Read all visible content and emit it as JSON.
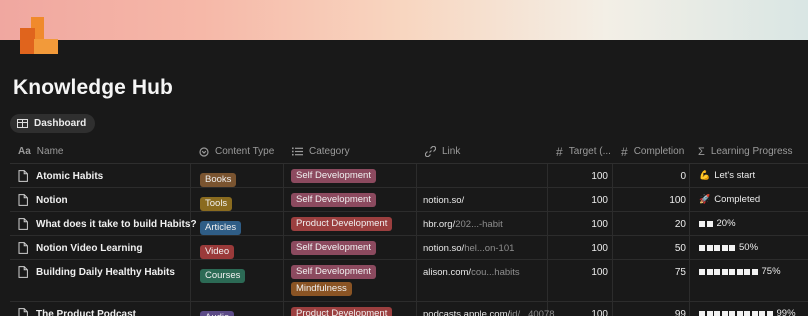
{
  "page": {
    "title": "Knowledge Hub"
  },
  "view": {
    "label": "Dashboard"
  },
  "columns": [
    {
      "label": "Name",
      "icon": "Aa"
    },
    {
      "label": "Content Type",
      "icon": "select-icon"
    },
    {
      "label": "Category",
      "icon": "multiselect-icon"
    },
    {
      "label": "Link",
      "icon": "link-icon"
    },
    {
      "label": "Target (...",
      "icon": "#"
    },
    {
      "label": "Completion",
      "icon": "#"
    },
    {
      "label": "Learning Progress",
      "icon": "Σ"
    }
  ],
  "rows": [
    {
      "name": "Atomic Habits",
      "type": "Books",
      "type_color": "#7a5430",
      "categories": [
        {
          "label": "Self Development",
          "color": "#8c4a5f"
        }
      ],
      "link": "",
      "link_dim": "",
      "target": "100",
      "completion": "0",
      "progress_emoji": "💪",
      "progress_text": "Let's start",
      "bar": 0
    },
    {
      "name": "Notion",
      "type": "Tools",
      "type_color": "#8a6b1f",
      "categories": [
        {
          "label": "Self Development",
          "color": "#8c4a5f"
        }
      ],
      "link": "notion.so/",
      "link_dim": "",
      "target": "100",
      "completion": "100",
      "progress_emoji": "🚀",
      "progress_text": "Completed",
      "bar": 0
    },
    {
      "name": "What does it take to build Habits?",
      "type": "Articles",
      "type_color": "#2f5d86",
      "categories": [
        {
          "label": "Product Development",
          "color": "#9b3f3f"
        }
      ],
      "link": "hbr.org/",
      "link_dim": "202...-habit",
      "target": "100",
      "completion": "20",
      "progress_emoji": "",
      "progress_text": "20%",
      "bar": 2
    },
    {
      "name": "Notion Video Learning",
      "type": "Video",
      "type_color": "#9a3a3a",
      "categories": [
        {
          "label": "Self Development",
          "color": "#8c4a5f"
        }
      ],
      "link": "notion.so/",
      "link_dim": "hel...on-101",
      "target": "100",
      "completion": "50",
      "progress_emoji": "",
      "progress_text": "50%",
      "bar": 5
    },
    {
      "name": "Building Daily Healthy Habits",
      "type": "Courses",
      "type_color": "#2c6a55",
      "categories": [
        {
          "label": "Self Development",
          "color": "#8c4a5f"
        },
        {
          "label": "Mindfulness",
          "color": "#8a5424"
        }
      ],
      "link": "alison.com/",
      "link_dim": "cou...habits",
      "target": "100",
      "completion": "75",
      "progress_emoji": "",
      "progress_text": "75%",
      "bar": 8
    },
    {
      "name": "The Product Podcast",
      "type": "Audio",
      "type_color": "#5b4a86",
      "categories": [
        {
          "label": "Product Development",
          "color": "#9b3f3f"
        }
      ],
      "link": "podcasts.apple.com/",
      "link_dim": "id/...40078",
      "target": "100",
      "completion": "99",
      "progress_emoji": "",
      "progress_text": "99%",
      "bar": 10
    }
  ]
}
